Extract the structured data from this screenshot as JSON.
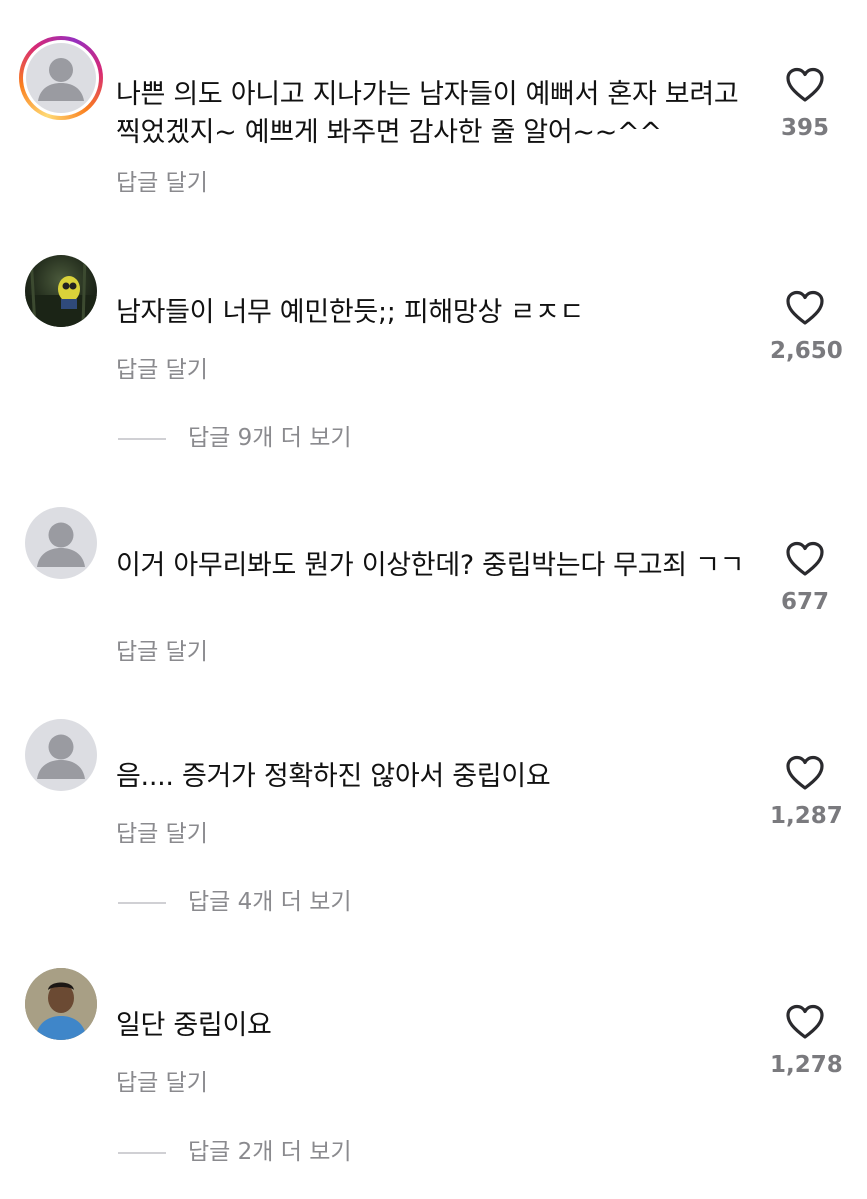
{
  "comments": [
    {
      "text": "나쁜 의도 아니고 지나가는 남자들이 예뻐서 혼자 보려고 찍었겠지~ 예쁘게 봐주면 감사한 줄 알어~~^^",
      "reply_label": "답글 달기",
      "likes": "395",
      "avatar": "default-avatar-story-ring"
    },
    {
      "text": "남자들이 너무 예민한듯;; 피해망상 ㄹㅈㄷ",
      "reply_label": "답글 달기",
      "likes": "2,650",
      "avatar": "photo-avatar",
      "view_replies": "답글 9개 더 보기"
    },
    {
      "text": "이거 아무리봐도 뭔가 이상한데? 중립박는다 무고죄 ㄱㄱ",
      "reply_label": "답글 달기",
      "likes": "677",
      "avatar": "default-avatar"
    },
    {
      "text": "음.... 증거가 정확하진 않아서 중립이요",
      "reply_label": "답글 달기",
      "likes": "1,287",
      "avatar": "default-avatar",
      "view_replies": "답글 4개 더 보기"
    },
    {
      "text": "일단 중립이요",
      "reply_label": "답글 달기",
      "likes": "1,278",
      "avatar": "photo-avatar",
      "view_replies": "답글 2개 더 보기"
    }
  ],
  "icons": {
    "like": "heart-outline-icon",
    "default_avatar": "person-silhouette-icon"
  },
  "colors": {
    "secondary_text": "#8a8a8e",
    "avatar_placeholder": "#dcdde2"
  }
}
